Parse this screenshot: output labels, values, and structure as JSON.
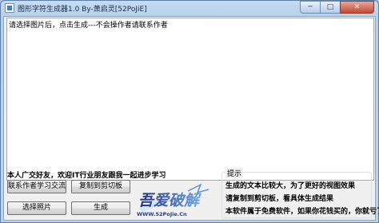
{
  "window": {
    "title": "图形字符生成器1.0 By-萧启灵[52PoJiE]",
    "minimize_glyph": "─",
    "maximize_glyph": "□",
    "close_glyph": "✕"
  },
  "output": {
    "text": "请选择图片后，点击生成---不会操作者请联系作者"
  },
  "promo": {
    "text": "本人广交好友，欢迎IT行业朋友跟我一起进步学习"
  },
  "buttons": {
    "contact": "联系作者学习交流",
    "copy": "复制到剪切板",
    "select_image": "选择照片",
    "generate": "生成"
  },
  "logo": {
    "text_main": "吾爱破解",
    "text_url": "WWW.52PoJie.Cn"
  },
  "tips": {
    "title": "提示",
    "items": [
      "生成的文本比较大，为了更好的视图效果",
      "请复制到剪切板，看具体生成结果",
      "本软件属于免费软件，如果你花钱买的，你就亏了"
    ]
  },
  "colors": {
    "titlebar": "#c5dcf2",
    "client_background": "#f0f0f0",
    "close_button": "#c24a35",
    "logo_blue": "#2a3d8f"
  }
}
